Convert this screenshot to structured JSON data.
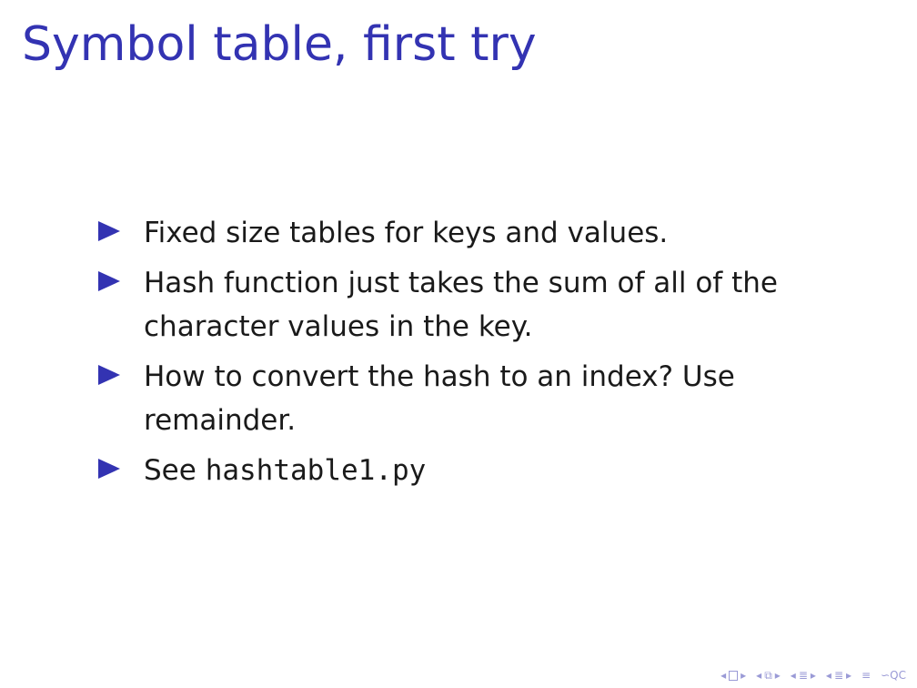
{
  "slide": {
    "title": "Symbol table, first try",
    "bullets": [
      {
        "text": "Fixed size tables for keys and values."
      },
      {
        "text": "Hash function just takes the sum of all of the character values in the key."
      },
      {
        "text": "How to convert the hash to an index? Use remainder."
      },
      {
        "prefix": "See ",
        "code": "hashtable1.py"
      }
    ]
  },
  "colors": {
    "accent": "#3333b2",
    "text": "#1a1a1a",
    "nav": "#9a9ad6"
  },
  "navigation": {
    "icons": [
      "nav-left-arrow",
      "nav-frame-box",
      "nav-right-arrow",
      "nav-left-arrow",
      "nav-subsection-box",
      "nav-right-arrow",
      "nav-left-arrow",
      "nav-section-icon",
      "nav-right-arrow",
      "nav-left-arrow",
      "nav-section-icon",
      "nav-right-arrow",
      "nav-align-icon",
      "nav-search-icon"
    ]
  }
}
